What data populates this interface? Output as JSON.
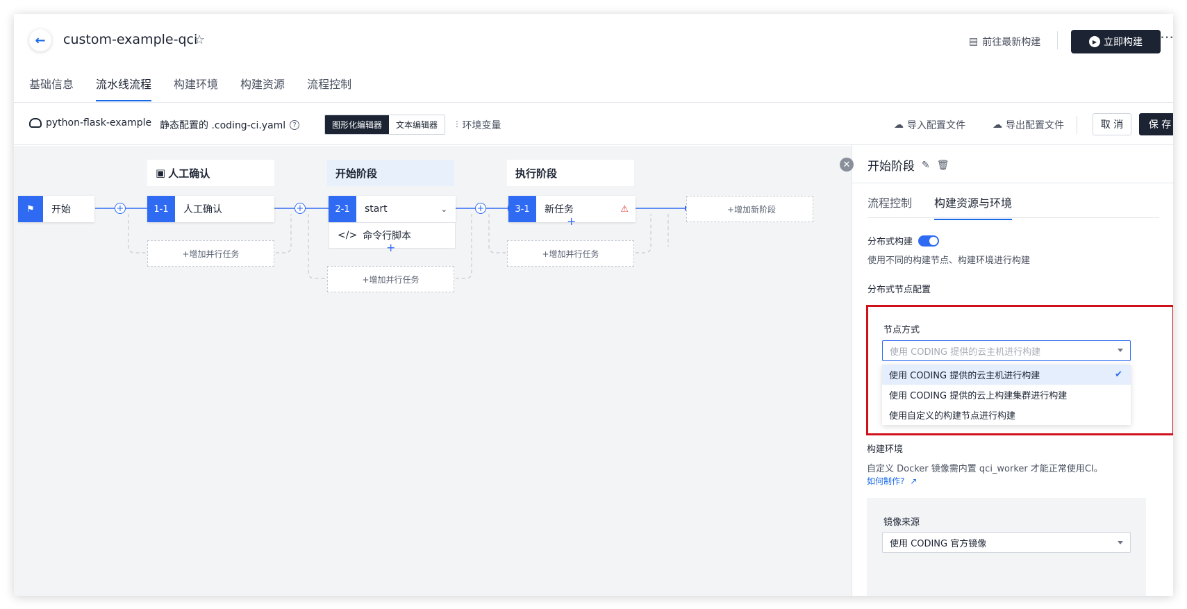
{
  "header": {
    "title": "custom-example-qci",
    "latest_build_link": "前往最新构建",
    "build_now": "立即构建"
  },
  "tabs": [
    "基础信息",
    "流水线流程",
    "构建环境",
    "构建资源",
    "流程控制"
  ],
  "toolbar": {
    "repo": "python-flask-example",
    "config_label": "静态配置的 .coding-ci.yaml",
    "graph_editor": "图形化编辑器",
    "text_editor": "文本编辑器",
    "env_vars": "环境变量",
    "import": "导入配置文件",
    "export": "导出配置文件",
    "cancel": "取 消",
    "save": "保 存"
  },
  "pipeline": {
    "start_label": "开始",
    "stages": [
      {
        "title": "人工确认",
        "task_idx": "1-1",
        "task_label": "人工确认"
      },
      {
        "title": "开始阶段",
        "task_idx": "2-1",
        "task_label": "start",
        "sub_task": "命令行脚本"
      },
      {
        "title": "执行阶段",
        "task_idx": "3-1",
        "task_label": "新任务"
      }
    ],
    "add_parallel": "+增加并行任务",
    "add_stage": "+增加新阶段"
  },
  "panel": {
    "title": "开始阶段",
    "tabs": [
      "流程控制",
      "构建资源与环境"
    ],
    "distributed_label": "分布式构建",
    "distributed_desc": "使用不同的构建节点、构建环境进行构建",
    "node_config_title": "分布式节点配置",
    "node_mode_label": "节点方式",
    "node_mode_placeholder": "使用 CODING 提供的云主机进行构建",
    "node_mode_options": [
      "使用 CODING 提供的云主机进行构建",
      "使用 CODING 提供的云上构建集群进行构建",
      "使用自定义的构建节点进行构建"
    ],
    "build_env_title": "构建环境",
    "build_env_desc": "自定义 Docker 镜像需内置 qci_worker 才能正常使用CI。",
    "howto_link": "如何制作?",
    "image_source_label": "镜像来源",
    "image_source_value": "使用 CODING 官方镜像"
  },
  "colors": {
    "accent": "#2f6bf2",
    "dark": "#1c2433",
    "highlight": "#d0111b"
  }
}
